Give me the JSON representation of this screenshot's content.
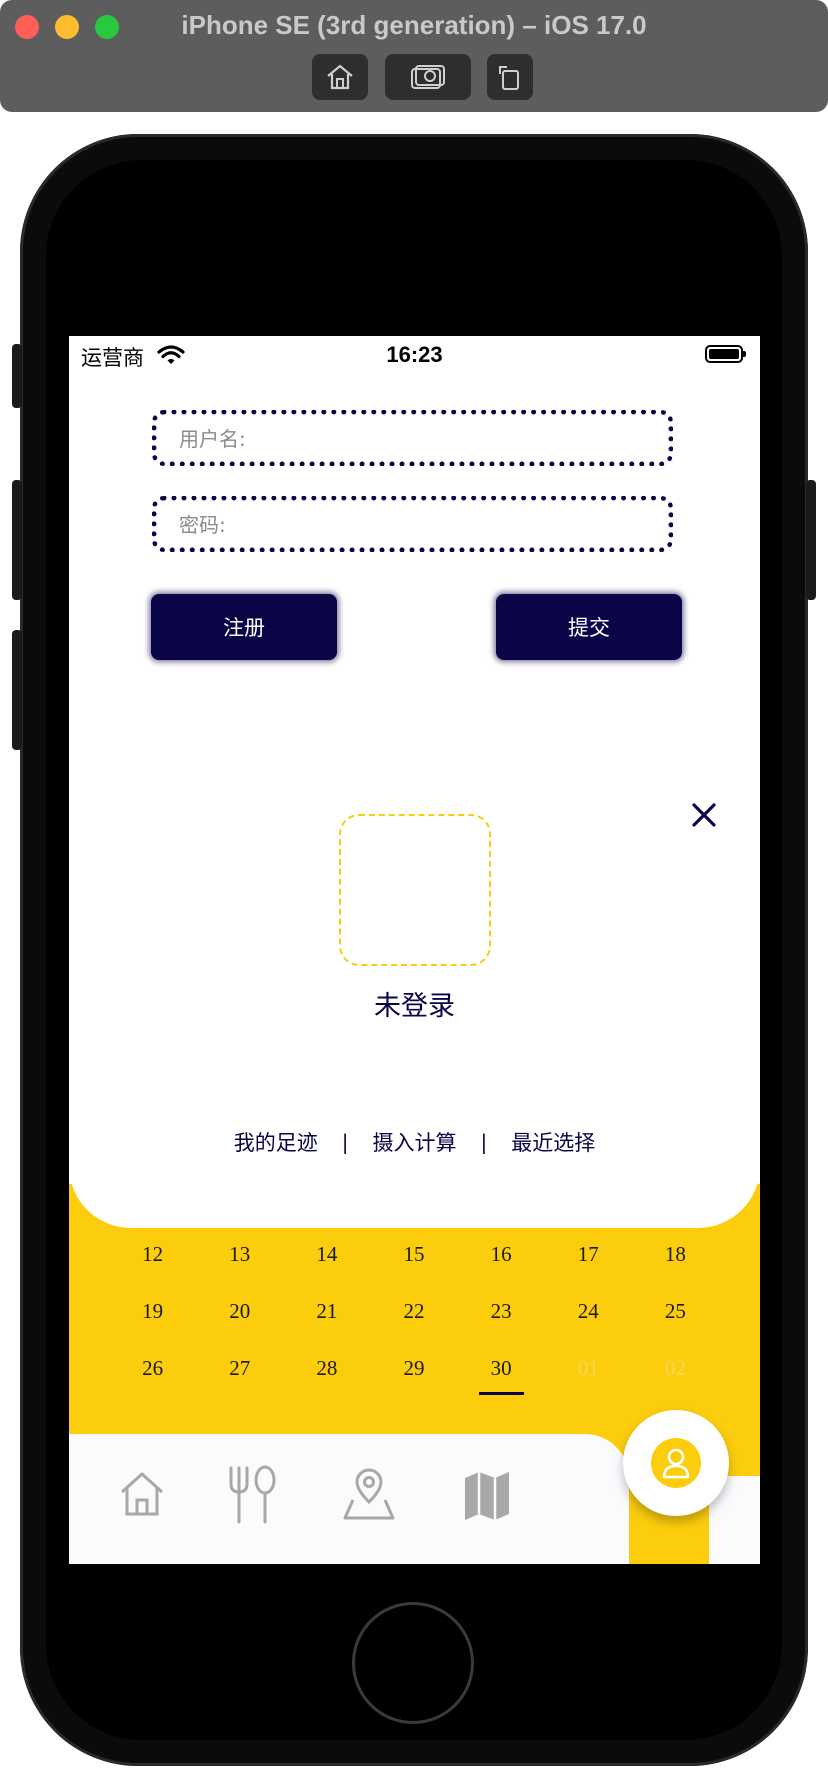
{
  "window": {
    "title": "iPhone SE (3rd generation) – iOS 17.0"
  },
  "status_bar": {
    "carrier": "运营商",
    "time": "16:23"
  },
  "login_form": {
    "username_placeholder": "用户名:",
    "password_placeholder": "密码:",
    "register_label": "注册",
    "submit_label": "提交"
  },
  "profile": {
    "status_text": "未登录"
  },
  "quick_links": {
    "footprint": "我的足迹",
    "intake_calc": "摄入计算",
    "recent_choice": "最近选择",
    "separator": "|"
  },
  "calendar": {
    "rows": [
      [
        "12",
        "13",
        "14",
        "15",
        "16",
        "17",
        "18"
      ],
      [
        "19",
        "20",
        "21",
        "22",
        "23",
        "24",
        "25"
      ],
      [
        "26",
        "27",
        "28",
        "29",
        "30",
        "01",
        "02"
      ]
    ],
    "today": "30",
    "muted": [
      "01",
      "02"
    ]
  },
  "tab_bar": {
    "tabs": [
      {
        "icon": "home-icon"
      },
      {
        "icon": "fork-spoon-icon"
      },
      {
        "icon": "location-pin-icon"
      },
      {
        "icon": "map-icon"
      }
    ],
    "fab_icon": "user-icon"
  },
  "colors": {
    "navy": "#090547",
    "yellow": "#fbcd0d",
    "tab_bar_bg": "#fbfafd",
    "icon_gray": "#a8a8a8"
  }
}
